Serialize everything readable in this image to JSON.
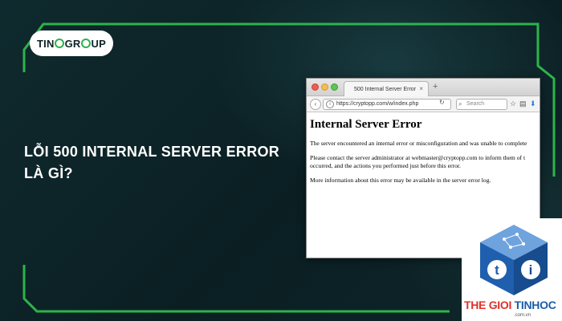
{
  "logo": {
    "text_before": "TIN",
    "text_after": "GR",
    "text_end": "UP",
    "icon": "tino-o-ring"
  },
  "headline": {
    "line1": "LỖI 500 INTERNAL SERVER ERROR",
    "line2": "LÀ GÌ?"
  },
  "browser": {
    "tab_title": "500 Internal Server Error",
    "tab_close": "×",
    "new_tab": "+",
    "url": "https://cryptopp.com/w/index.php",
    "search_placeholder": "Search",
    "page_heading": "Internal Server Error",
    "para1": "The server encountered an internal error or misconfiguration and was unable to complete",
    "para2_line1": "Please contact the server administrator at webmaster@cryptopp.com to inform them of t",
    "para2_line2": "occurred, and the actions you performed just before this error.",
    "para3": "More information about this error may be available in the server error log."
  },
  "badge": {
    "brand_red": "THE GIOI ",
    "brand_blue": "TINHOC",
    "domain": ".com.vn"
  },
  "colors": {
    "background": "#0d2327",
    "accent_green": "#2db34a",
    "brand_red": "#e0312b",
    "brand_blue": "#1a5ea8"
  }
}
